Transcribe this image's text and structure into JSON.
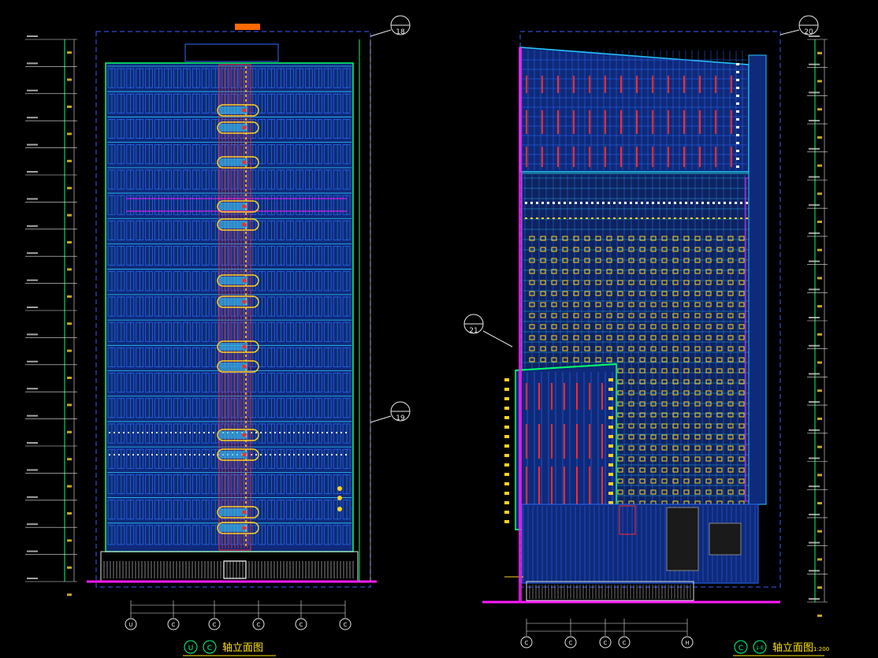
{
  "drawing": {
    "background": "#000000",
    "colors": {
      "facade_blue": "#2a6cff",
      "window_cyan": "#27c9ff",
      "panel_red": "#ff2a2a",
      "accent_yellow": "#ffd21f",
      "ground_magenta": "#ff1aff",
      "frame_green": "#00ff6a",
      "dim_white": "#e8e8e8",
      "title_yellow": "#ffe600",
      "bubble_green": "#00ff80"
    },
    "left_view": {
      "title": "轴立面图",
      "axis_prefix": "C",
      "grid_axes": [
        "U",
        "C",
        "C",
        "C",
        "C",
        "C"
      ],
      "section_markers": [
        "18",
        "19"
      ],
      "floors": 19
    },
    "right_view": {
      "title": "轴立面图",
      "axis_prefix": "C",
      "axis_range": "1-E",
      "scale": "1:200",
      "section_markers": [
        "20",
        "21"
      ],
      "floors": 19
    }
  }
}
